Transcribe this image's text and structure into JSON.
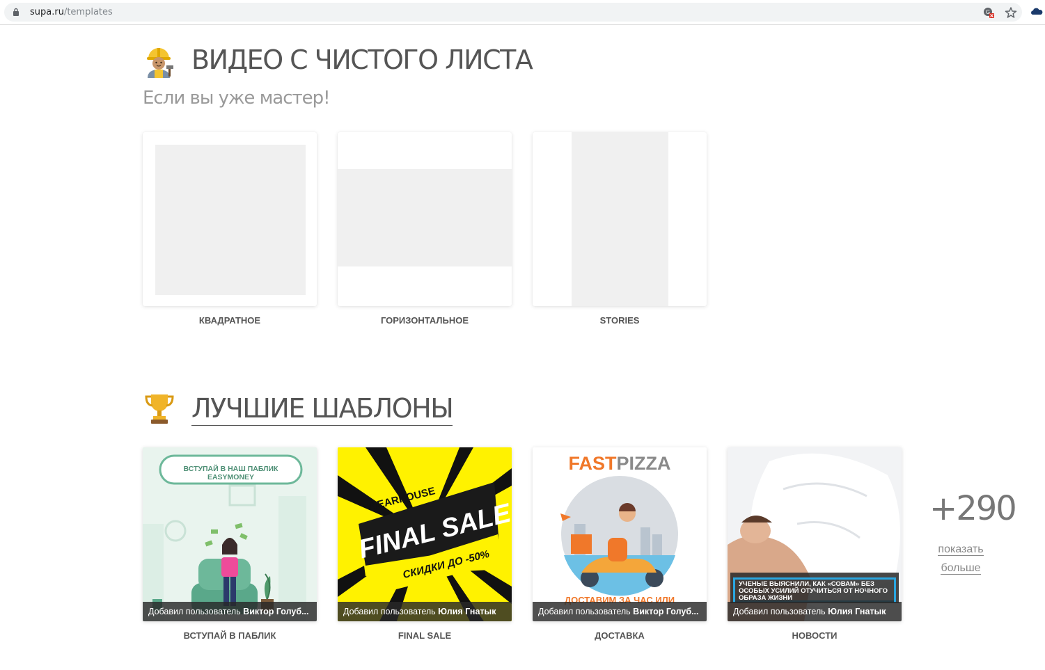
{
  "browser": {
    "url_host": "supa.ru",
    "url_path": "/templates"
  },
  "blank_section": {
    "title": "ВИДЕО С ЧИСТОГО ЛИСТА",
    "subtitle": "Если вы уже мастер!",
    "formats": [
      {
        "label": "КВАДРАТНОЕ"
      },
      {
        "label": "ГОРИЗОНТАЛЬНОЕ"
      },
      {
        "label": "STORIES"
      }
    ]
  },
  "best_section": {
    "title": "ЛУЧШИЕ ШАБЛОНЫ",
    "templates": [
      {
        "label": "ВСТУПАЙ В ПАБЛИК",
        "author_prefix": "Добавил пользователь",
        "author": "Виктор Голуб...",
        "banner": "ВСТУПАЙ В НАШ ПАБЛИК EASYMONEY"
      },
      {
        "label": "FINAL SALE",
        "author_prefix": "Добавил пользователь",
        "author": "Юлия Гнатык",
        "brand": "WEARHOUSE",
        "headline": "FINAL SALE",
        "discount": "СКИДКИ ДО -50%"
      },
      {
        "label": "ДОСТАВКА",
        "author_prefix": "Добавил пользователь",
        "author": "Виктор Голуб...",
        "logo_a": "FAST",
        "logo_b": "PIZZA",
        "caption": "ДОСТАВИМ ЗА ЧАС ИЛИ"
      },
      {
        "label": "НОВОСТИ",
        "author_prefix": "Добавил пользователь",
        "author": "Юлия Гнатык",
        "news": "УЧЕНЫЕ ВЫЯСНИЛИ, КАК «СОВАМ» БЕЗ ОСОБЫХ УСИЛИЙ ОТУЧИТЬСЯ ОТ НОЧНОГО ОБРАЗА ЖИЗНИ"
      }
    ],
    "more_count": "+290",
    "more_link_line1": "показать",
    "more_link_line2": "больше"
  },
  "colors": {
    "pizza_orange": "#f0782a",
    "pizza_gray": "#8a8a8a",
    "sale_yellow": "#fff200",
    "news_frame": "#2aa6e0"
  }
}
